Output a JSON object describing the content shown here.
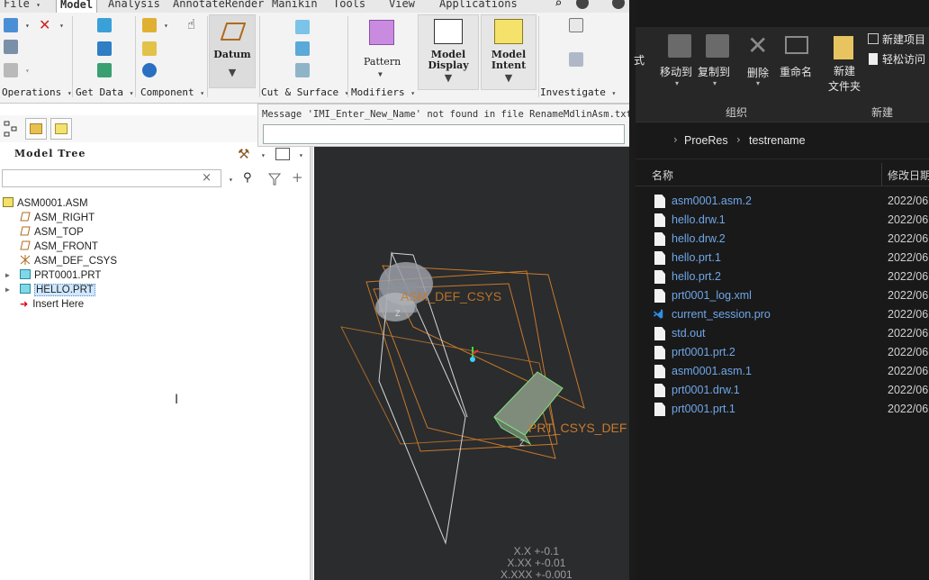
{
  "menubar": {
    "file": "File",
    "model": "Model",
    "analysis": "Analysis",
    "annotate": "Annotate",
    "render": "Render",
    "manikin": "Manikin",
    "tools": "Tools",
    "view": "View",
    "applications": "Applications"
  },
  "ribbon": {
    "groups": {
      "operations": "Operations",
      "get_data": "Get Data",
      "component": "Component",
      "cut_surface": "Cut & Surface",
      "modifiers": "Modifiers",
      "investigate": "Investigate"
    },
    "datum": "Datum",
    "pattern": "Pattern",
    "model_display": [
      "Model",
      "Display"
    ],
    "model_intent": [
      "Model",
      "Intent"
    ]
  },
  "message_bar": {
    "text": "Message 'IMI_Enter_New_Name' not found in file RenameMdlinAsm.txt.",
    "ok": "✔",
    "cancel": "✖"
  },
  "model_tree": {
    "title": "Model Tree",
    "search_clear": "×",
    "nodes": [
      "ASM0001.ASM",
      "ASM_RIGHT",
      "ASM_TOP",
      "ASM_FRONT",
      "ASM_DEF_CSYS",
      "PRT0001.PRT",
      "HELLO.PRT",
      "Insert Here"
    ]
  },
  "viewport": {
    "labels": {
      "asm_csys": "ASM_DEF_CSYS",
      "prt_csys": "PRT_CSYS_DEF",
      "z1": "Z",
      "z2": "Z"
    },
    "tolerance": [
      "X.X +-0.1",
      "X.XX +-0.01",
      "X.XXX +-0.001"
    ]
  },
  "explorer": {
    "ribbon": {
      "style_frag": "式",
      "move_to": "移动到",
      "copy_to": "复制到",
      "delete": "删除",
      "rename": "重命名",
      "new_folder": [
        "新建",
        "文件夹"
      ],
      "new_item": "新建项目",
      "easy_access": "轻松访问",
      "group_organize": "组织",
      "group_new": "新建"
    },
    "breadcrumb": [
      "ProeRes",
      "testrename"
    ],
    "headers": {
      "name": "名称",
      "date": "修改日期"
    },
    "files": [
      {
        "name": "asm0001.asm.2",
        "date": "2022/06"
      },
      {
        "name": "hello.drw.1",
        "date": "2022/06"
      },
      {
        "name": "hello.drw.2",
        "date": "2022/06"
      },
      {
        "name": "hello.prt.1",
        "date": "2022/06"
      },
      {
        "name": "hello.prt.2",
        "date": "2022/06"
      },
      {
        "name": "prt0001_log.xml",
        "date": "2022/06"
      },
      {
        "name": "current_session.pro",
        "date": "2022/06"
      },
      {
        "name": "std.out",
        "date": "2022/06"
      },
      {
        "name": "prt0001.prt.2",
        "date": "2022/06"
      },
      {
        "name": "asm0001.asm.1",
        "date": "2022/06"
      },
      {
        "name": "prt0001.drw.1",
        "date": "2022/06"
      },
      {
        "name": "prt0001.prt.1",
        "date": "2022/06"
      }
    ]
  },
  "colors": {
    "explorer_bg": "#191919",
    "link_blue": "#6fa7e8",
    "viewport_bg": "#2b2c2e",
    "datum_orange": "#c77a2a",
    "selection_blue": "#7fd0ff"
  }
}
